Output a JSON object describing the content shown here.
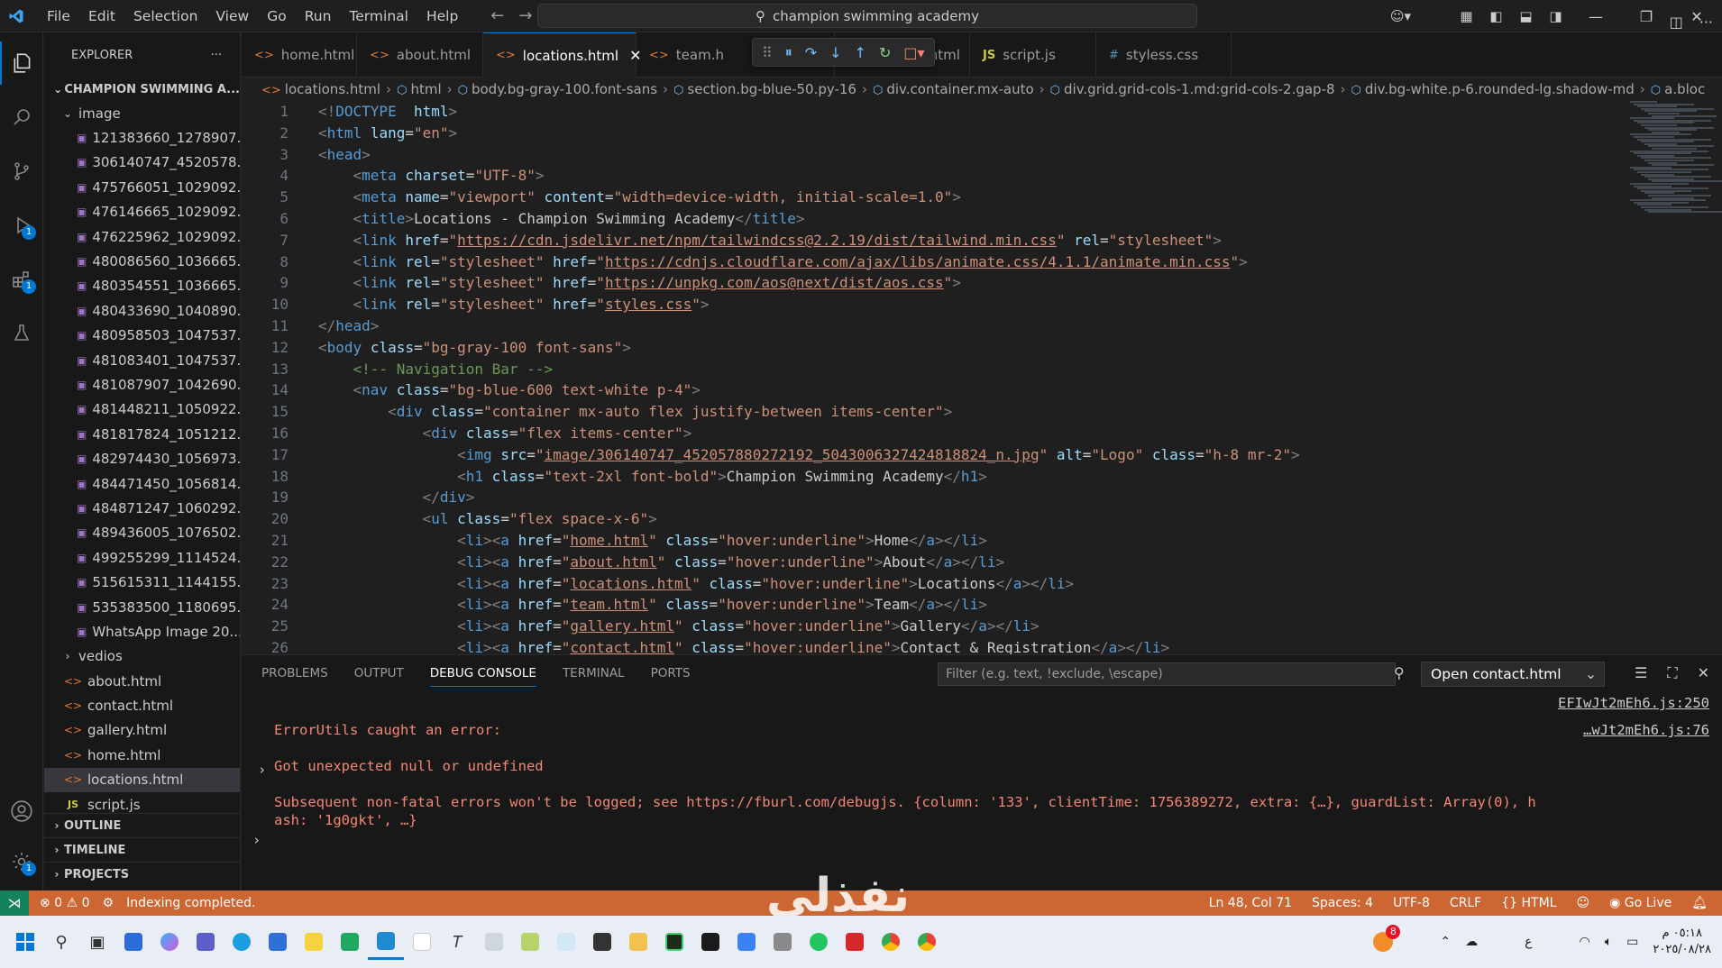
{
  "menu": [
    "File",
    "Edit",
    "Selection",
    "View",
    "Go",
    "Run",
    "Terminal",
    "Help"
  ],
  "search": {
    "text": "champion swimming academy"
  },
  "sidebar": {
    "title": "EXPLORER",
    "more": "···",
    "root": "CHAMPION SWIMMING A...",
    "folder_image": "image",
    "files_image": [
      "121383660_1278907...",
      "306140747_4520578...",
      "475766051_1029092...",
      "476146665_1029092...",
      "476225962_1029092...",
      "480086560_1036665...",
      "480354551_1036665...",
      "480433690_1040890...",
      "480958503_1047537...",
      "481083401_1047537...",
      "481087907_1042690...",
      "481448211_1050922...",
      "481817824_1051212...",
      "482974430_1056973...",
      "484471450_1056814...",
      "484871247_1060292...",
      "489436005_1076502...",
      "499255299_1114524...",
      "515615311_1144155...",
      "535383500_1180695...",
      "WhatsApp Image 20..."
    ],
    "folder_vedios": "vedios",
    "root_files": [
      {
        "name": "about.html",
        "type": "html"
      },
      {
        "name": "contact.html",
        "type": "html"
      },
      {
        "name": "gallery.html",
        "type": "html"
      },
      {
        "name": "home.html",
        "type": "html"
      },
      {
        "name": "locations.html",
        "type": "html"
      },
      {
        "name": "script.js",
        "type": "js"
      }
    ],
    "sections": [
      "OUTLINE",
      "TIMELINE",
      "PROJECTS"
    ]
  },
  "activity_badges": {
    "run": "1",
    "extensions": "1",
    "settings": "1"
  },
  "tabs": [
    {
      "label": "home.html",
      "icon": "html",
      "active": false
    },
    {
      "label": "about.html",
      "icon": "html",
      "active": false
    },
    {
      "label": "locations.html",
      "icon": "html",
      "active": true
    },
    {
      "label": "team.h",
      "icon": "html",
      "active": false
    },
    {
      "label": "contact.html",
      "icon": "html",
      "active": false
    },
    {
      "label": "script.js",
      "icon": "js",
      "active": false
    },
    {
      "label": "styless.css",
      "icon": "css",
      "active": false
    }
  ],
  "breadcrumbs": [
    "locations.html",
    "html",
    "body.bg-gray-100.font-sans",
    "section.bg-blue-50.py-16",
    "div.container.mx-auto",
    "div.grid.grid-cols-1.md:grid-cols-2.gap-8",
    "div.bg-white.p-6.rounded-lg.shadow-md",
    "a.bloc"
  ],
  "code_lines": [
    [
      [
        "b",
        "<!"
      ],
      [
        "t",
        "DOCTYPE"
      ],
      [
        "",
        "  "
      ],
      [
        "a",
        "html"
      ],
      [
        "b",
        ">"
      ]
    ],
    [
      [
        "b",
        "<"
      ],
      [
        "t",
        "html"
      ],
      [
        "",
        " "
      ],
      [
        "a",
        "lang"
      ],
      [
        "",
        "="
      ],
      [
        "s",
        "\"en\""
      ],
      [
        "b",
        ">"
      ]
    ],
    [
      [
        "b",
        "<"
      ],
      [
        "t",
        "head"
      ],
      [
        "b",
        ">"
      ]
    ],
    [
      [
        "",
        "    "
      ],
      [
        "b",
        "<"
      ],
      [
        "t",
        "meta"
      ],
      [
        "",
        " "
      ],
      [
        "a",
        "charset"
      ],
      [
        "",
        "="
      ],
      [
        "s",
        "\"UTF-8\""
      ],
      [
        "b",
        ">"
      ]
    ],
    [
      [
        "",
        "    "
      ],
      [
        "b",
        "<"
      ],
      [
        "t",
        "meta"
      ],
      [
        "",
        " "
      ],
      [
        "a",
        "name"
      ],
      [
        "",
        "="
      ],
      [
        "s",
        "\"viewport\""
      ],
      [
        "",
        " "
      ],
      [
        "a",
        "content"
      ],
      [
        "",
        "="
      ],
      [
        "s",
        "\"width=device-width, initial-scale=1.0\""
      ],
      [
        "b",
        ">"
      ]
    ],
    [
      [
        "",
        "    "
      ],
      [
        "b",
        "<"
      ],
      [
        "t",
        "title"
      ],
      [
        "b",
        ">"
      ],
      [
        "",
        "Locations - Champion Swimming Academy"
      ],
      [
        "b",
        "</"
      ],
      [
        "t",
        "title"
      ],
      [
        "b",
        ">"
      ]
    ],
    [
      [
        "",
        "    "
      ],
      [
        "b",
        "<"
      ],
      [
        "t",
        "link"
      ],
      [
        "",
        " "
      ],
      [
        "a",
        "href"
      ],
      [
        "",
        "="
      ],
      [
        "s",
        "\""
      ],
      [
        "su",
        "https://cdn.jsdelivr.net/npm/tailwindcss@2.2.19/dist/tailwind.min.css"
      ],
      [
        "s",
        "\""
      ],
      [
        "",
        " "
      ],
      [
        "a",
        "rel"
      ],
      [
        "",
        "="
      ],
      [
        "s",
        "\"stylesheet\""
      ],
      [
        "b",
        ">"
      ]
    ],
    [
      [
        "",
        "    "
      ],
      [
        "b",
        "<"
      ],
      [
        "t",
        "link"
      ],
      [
        "",
        " "
      ],
      [
        "a",
        "rel"
      ],
      [
        "",
        "="
      ],
      [
        "s",
        "\"stylesheet\""
      ],
      [
        "",
        " "
      ],
      [
        "a",
        "href"
      ],
      [
        "",
        "="
      ],
      [
        "s",
        "\""
      ],
      [
        "su",
        "https://cdnjs.cloudflare.com/ajax/libs/animate.css/4.1.1/animate.min.css"
      ],
      [
        "s",
        "\""
      ],
      [
        "b",
        ">"
      ]
    ],
    [
      [
        "",
        "    "
      ],
      [
        "b",
        "<"
      ],
      [
        "t",
        "link"
      ],
      [
        "",
        " "
      ],
      [
        "a",
        "rel"
      ],
      [
        "",
        "="
      ],
      [
        "s",
        "\"stylesheet\""
      ],
      [
        "",
        " "
      ],
      [
        "a",
        "href"
      ],
      [
        "",
        "="
      ],
      [
        "s",
        "\""
      ],
      [
        "su",
        "https://unpkg.com/aos@next/dist/aos.css"
      ],
      [
        "s",
        "\""
      ],
      [
        "b",
        ">"
      ]
    ],
    [
      [
        "",
        "    "
      ],
      [
        "b",
        "<"
      ],
      [
        "t",
        "link"
      ],
      [
        "",
        " "
      ],
      [
        "a",
        "rel"
      ],
      [
        "",
        "="
      ],
      [
        "s",
        "\"stylesheet\""
      ],
      [
        "",
        " "
      ],
      [
        "a",
        "href"
      ],
      [
        "",
        "="
      ],
      [
        "s",
        "\""
      ],
      [
        "su",
        "styles.css"
      ],
      [
        "s",
        "\""
      ],
      [
        "b",
        ">"
      ]
    ],
    [
      [
        "b",
        "</"
      ],
      [
        "t",
        "head"
      ],
      [
        "b",
        ">"
      ]
    ],
    [
      [
        "b",
        "<"
      ],
      [
        "t",
        "body"
      ],
      [
        "",
        " "
      ],
      [
        "a",
        "class"
      ],
      [
        "",
        "="
      ],
      [
        "s",
        "\"bg-gray-100 font-sans\""
      ],
      [
        "b",
        ">"
      ]
    ],
    [
      [
        "",
        "    "
      ],
      [
        "c",
        "<!-- Navigation Bar -->"
      ]
    ],
    [
      [
        "",
        "    "
      ],
      [
        "b",
        "<"
      ],
      [
        "t",
        "nav"
      ],
      [
        "",
        " "
      ],
      [
        "a",
        "class"
      ],
      [
        "",
        "="
      ],
      [
        "s",
        "\"bg-blue-600 text-white p-4\""
      ],
      [
        "b",
        ">"
      ]
    ],
    [
      [
        "",
        "        "
      ],
      [
        "b",
        "<"
      ],
      [
        "t",
        "div"
      ],
      [
        "",
        " "
      ],
      [
        "a",
        "class"
      ],
      [
        "",
        "="
      ],
      [
        "s",
        "\"container mx-auto flex justify-between items-center\""
      ],
      [
        "b",
        ">"
      ]
    ],
    [
      [
        "",
        "            "
      ],
      [
        "b",
        "<"
      ],
      [
        "t",
        "div"
      ],
      [
        "",
        " "
      ],
      [
        "a",
        "class"
      ],
      [
        "",
        "="
      ],
      [
        "s",
        "\"flex items-center\""
      ],
      [
        "b",
        ">"
      ]
    ],
    [
      [
        "",
        "                "
      ],
      [
        "b",
        "<"
      ],
      [
        "t",
        "img"
      ],
      [
        "",
        " "
      ],
      [
        "a",
        "src"
      ],
      [
        "",
        "="
      ],
      [
        "s",
        "\""
      ],
      [
        "su",
        "image/306140747_452057880272192_5043006327424818824_n.jpg"
      ],
      [
        "s",
        "\""
      ],
      [
        "",
        " "
      ],
      [
        "a",
        "alt"
      ],
      [
        "",
        "="
      ],
      [
        "s",
        "\"Logo\""
      ],
      [
        "",
        " "
      ],
      [
        "a",
        "class"
      ],
      [
        "",
        "="
      ],
      [
        "s",
        "\"h-8 mr-2\""
      ],
      [
        "b",
        ">"
      ]
    ],
    [
      [
        "",
        "                "
      ],
      [
        "b",
        "<"
      ],
      [
        "t",
        "h1"
      ],
      [
        "",
        " "
      ],
      [
        "a",
        "class"
      ],
      [
        "",
        "="
      ],
      [
        "s",
        "\"text-2xl font-bold\""
      ],
      [
        "b",
        ">"
      ],
      [
        "",
        "Champion Swimming Academy"
      ],
      [
        "b",
        "</"
      ],
      [
        "t",
        "h1"
      ],
      [
        "b",
        ">"
      ]
    ],
    [
      [
        "",
        "            "
      ],
      [
        "b",
        "</"
      ],
      [
        "t",
        "div"
      ],
      [
        "b",
        ">"
      ]
    ],
    [
      [
        "",
        "            "
      ],
      [
        "b",
        "<"
      ],
      [
        "t",
        "ul"
      ],
      [
        "",
        " "
      ],
      [
        "a",
        "class"
      ],
      [
        "",
        "="
      ],
      [
        "s",
        "\"flex space-x-6\""
      ],
      [
        "b",
        ">"
      ]
    ],
    [
      [
        "",
        "                "
      ],
      [
        "b",
        "<"
      ],
      [
        "t",
        "li"
      ],
      [
        "b",
        "><"
      ],
      [
        "t",
        "a"
      ],
      [
        "",
        " "
      ],
      [
        "a",
        "href"
      ],
      [
        "",
        "="
      ],
      [
        "s",
        "\""
      ],
      [
        "su",
        "home.html"
      ],
      [
        "s",
        "\""
      ],
      [
        "",
        " "
      ],
      [
        "a",
        "class"
      ],
      [
        "",
        "="
      ],
      [
        "s",
        "\"hover:underline\""
      ],
      [
        "b",
        ">"
      ],
      [
        "",
        "Home"
      ],
      [
        "b",
        "</"
      ],
      [
        "t",
        "a"
      ],
      [
        "b",
        "></"
      ],
      [
        "t",
        "li"
      ],
      [
        "b",
        ">"
      ]
    ],
    [
      [
        "",
        "                "
      ],
      [
        "b",
        "<"
      ],
      [
        "t",
        "li"
      ],
      [
        "b",
        "><"
      ],
      [
        "t",
        "a"
      ],
      [
        "",
        " "
      ],
      [
        "a",
        "href"
      ],
      [
        "",
        "="
      ],
      [
        "s",
        "\""
      ],
      [
        "su",
        "about.html"
      ],
      [
        "s",
        "\""
      ],
      [
        "",
        " "
      ],
      [
        "a",
        "class"
      ],
      [
        "",
        "="
      ],
      [
        "s",
        "\"hover:underline\""
      ],
      [
        "b",
        ">"
      ],
      [
        "",
        "About"
      ],
      [
        "b",
        "</"
      ],
      [
        "t",
        "a"
      ],
      [
        "b",
        "></"
      ],
      [
        "t",
        "li"
      ],
      [
        "b",
        ">"
      ]
    ],
    [
      [
        "",
        "                "
      ],
      [
        "b",
        "<"
      ],
      [
        "t",
        "li"
      ],
      [
        "b",
        "><"
      ],
      [
        "t",
        "a"
      ],
      [
        "",
        " "
      ],
      [
        "a",
        "href"
      ],
      [
        "",
        "="
      ],
      [
        "s",
        "\""
      ],
      [
        "su",
        "locations.html"
      ],
      [
        "s",
        "\""
      ],
      [
        "",
        " "
      ],
      [
        "a",
        "class"
      ],
      [
        "",
        "="
      ],
      [
        "s",
        "\"hover:underline\""
      ],
      [
        "b",
        ">"
      ],
      [
        "",
        "Locations"
      ],
      [
        "b",
        "</"
      ],
      [
        "t",
        "a"
      ],
      [
        "b",
        "></"
      ],
      [
        "t",
        "li"
      ],
      [
        "b",
        ">"
      ]
    ],
    [
      [
        "",
        "                "
      ],
      [
        "b",
        "<"
      ],
      [
        "t",
        "li"
      ],
      [
        "b",
        "><"
      ],
      [
        "t",
        "a"
      ],
      [
        "",
        " "
      ],
      [
        "a",
        "href"
      ],
      [
        "",
        "="
      ],
      [
        "s",
        "\""
      ],
      [
        "su",
        "team.html"
      ],
      [
        "s",
        "\""
      ],
      [
        "",
        " "
      ],
      [
        "a",
        "class"
      ],
      [
        "",
        "="
      ],
      [
        "s",
        "\"hover:underline\""
      ],
      [
        "b",
        ">"
      ],
      [
        "",
        "Team"
      ],
      [
        "b",
        "</"
      ],
      [
        "t",
        "a"
      ],
      [
        "b",
        "></"
      ],
      [
        "t",
        "li"
      ],
      [
        "b",
        ">"
      ]
    ],
    [
      [
        "",
        "                "
      ],
      [
        "b",
        "<"
      ],
      [
        "t",
        "li"
      ],
      [
        "b",
        "><"
      ],
      [
        "t",
        "a"
      ],
      [
        "",
        " "
      ],
      [
        "a",
        "href"
      ],
      [
        "",
        "="
      ],
      [
        "s",
        "\""
      ],
      [
        "su",
        "gallery.html"
      ],
      [
        "s",
        "\""
      ],
      [
        "",
        " "
      ],
      [
        "a",
        "class"
      ],
      [
        "",
        "="
      ],
      [
        "s",
        "\"hover:underline\""
      ],
      [
        "b",
        ">"
      ],
      [
        "",
        "Gallery"
      ],
      [
        "b",
        "</"
      ],
      [
        "t",
        "a"
      ],
      [
        "b",
        "></"
      ],
      [
        "t",
        "li"
      ],
      [
        "b",
        ">"
      ]
    ],
    [
      [
        "",
        "                "
      ],
      [
        "b",
        "<"
      ],
      [
        "t",
        "li"
      ],
      [
        "b",
        "><"
      ],
      [
        "t",
        "a"
      ],
      [
        "",
        " "
      ],
      [
        "a",
        "href"
      ],
      [
        "",
        "="
      ],
      [
        "s",
        "\""
      ],
      [
        "su",
        "contact.html"
      ],
      [
        "s",
        "\""
      ],
      [
        "",
        " "
      ],
      [
        "a",
        "class"
      ],
      [
        "",
        "="
      ],
      [
        "s",
        "\"hover:underline\""
      ],
      [
        "b",
        ">"
      ],
      [
        "",
        "Contact & Registration"
      ],
      [
        "b",
        "</"
      ],
      [
        "t",
        "a"
      ],
      [
        "b",
        "></"
      ],
      [
        "t",
        "li"
      ],
      [
        "b",
        ">"
      ]
    ]
  ],
  "panel": {
    "tabs": [
      "PROBLEMS",
      "OUTPUT",
      "DEBUG CONSOLE",
      "TERMINAL",
      "PORTS"
    ],
    "active_tab": "DEBUG CONSOLE",
    "filter_placeholder": "Filter (e.g. text, !exclude, \\escape)",
    "select_value": "Open contact.html",
    "console": {
      "src1": "EFIwJt2mEh6.js:250",
      "src2": "…wJt2mEh6.js:76",
      "line1": "ErrorUtils caught an error:",
      "line2": "Got unexpected null or undefined",
      "line3": "Subsequent non-fatal errors won't be logged; see https://fburl.com/debugjs. {column: '133', clientTime: 1756389272, extra: {…}, guardList: Array(0), h",
      "line4": "ash: '1g0gkt', …}"
    }
  },
  "status": {
    "errors": "0",
    "warnings": "0",
    "message": "Indexing completed.",
    "position": "Ln 48, Col 71",
    "spaces": "Spaces: 4",
    "encoding": "UTF-8",
    "eol": "CRLF",
    "language": "HTML",
    "golive": "Go Live"
  },
  "watermark": "نفذلي",
  "taskbar": {
    "notification_badge": "8",
    "time": "٠٥:١٨ م",
    "date": "٢٠٢٥/٠٨/٢٨",
    "lang": "ع"
  },
  "colors": {
    "accent": "#0078d4",
    "status_bar": "#cc6633",
    "remote": "#16825d",
    "error_text": "#f48771"
  }
}
